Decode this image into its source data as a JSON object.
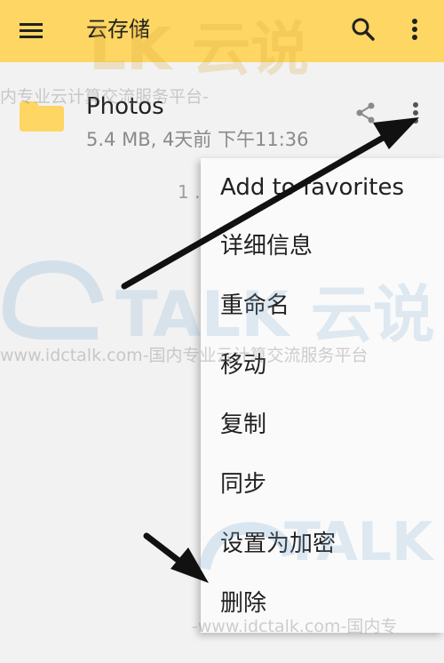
{
  "appbar": {
    "title": "云存储",
    "menu_icon": "hamburger-menu-icon",
    "search_icon": "search-icon",
    "more_icon": "more-vertical-icon",
    "background": "#fdd663"
  },
  "file": {
    "name": "Photos",
    "meta": "5.4 MB, 4天前 下午11:36",
    "icon": "folder-icon",
    "icon_color": "#fdd663",
    "share_icon": "share-icon",
    "more_icon": "more-vertical-icon"
  },
  "partial_text": "1 .",
  "context_menu": {
    "items": [
      {
        "label": "Add to favorites"
      },
      {
        "label": "详细信息"
      },
      {
        "label": "重命名"
      },
      {
        "label": "移动"
      },
      {
        "label": "复制"
      },
      {
        "label": "同步"
      },
      {
        "label": "设置为加密"
      },
      {
        "label": "删除"
      }
    ]
  },
  "watermark": {
    "top_text": "LK 云说",
    "top_sub": "内专业云计算交流服务平台-",
    "mid_text": "TALK 云说",
    "mid_sub": "www.idctalk.com-国内专业云计算交流服务平台",
    "bottom_text": "TALK",
    "bottom_sub": "-www.idctalk.com-国内专"
  }
}
